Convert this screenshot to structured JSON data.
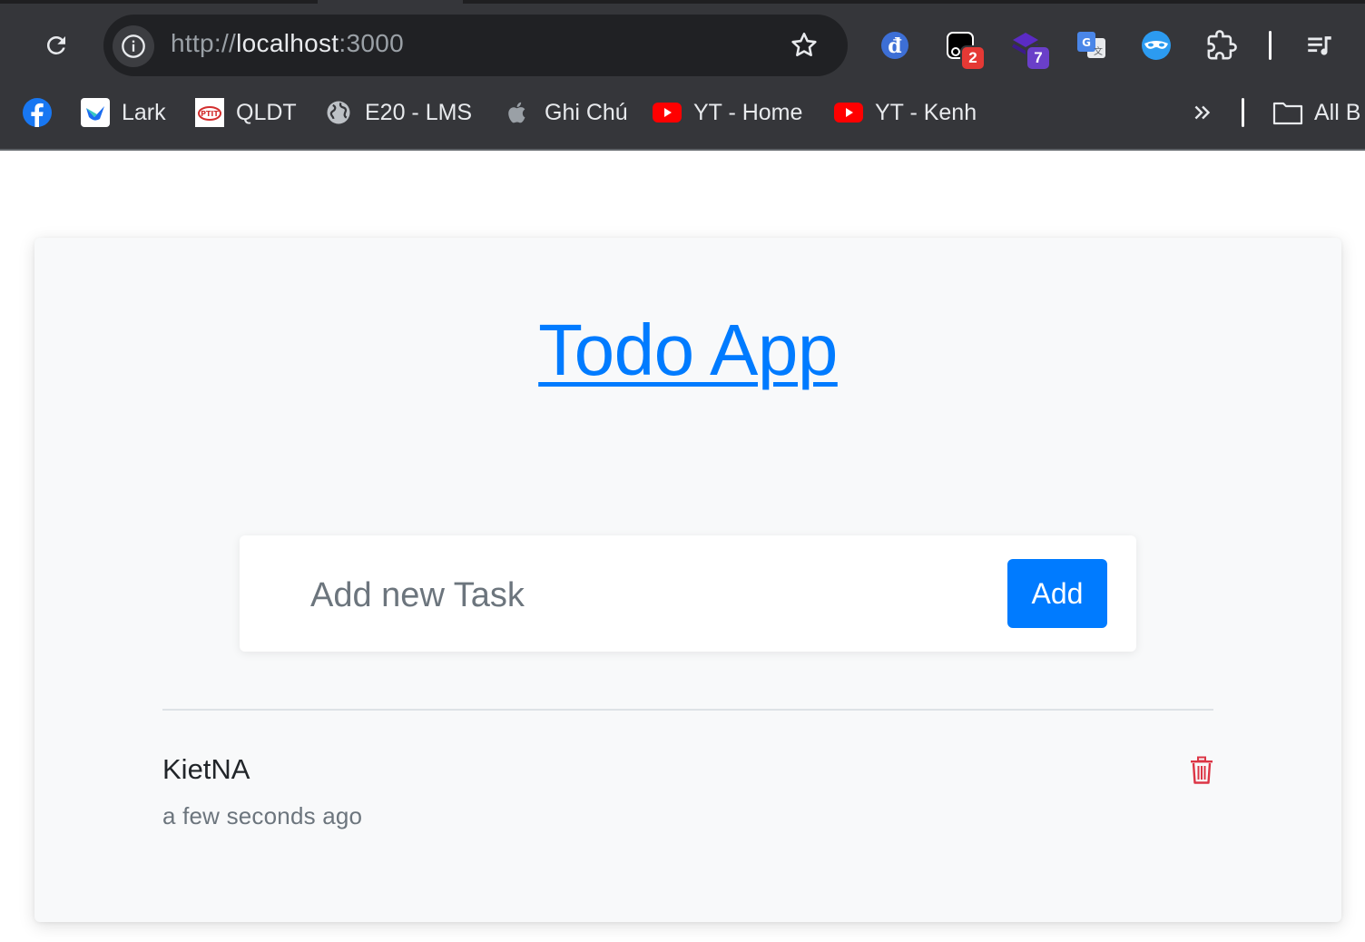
{
  "browser": {
    "url_scheme": "http://",
    "url_host": "localhost",
    "url_port": ":3000",
    "extensions": [
      {
        "icon": "dong-icon"
      },
      {
        "icon": "screenshot-ext-icon",
        "badge": "2",
        "badge_color": "#e53935"
      },
      {
        "icon": "stack-ext-icon",
        "badge": "7",
        "badge_color": "#6a3fc9"
      },
      {
        "icon": "google-translate-icon"
      },
      {
        "icon": "mask-ext-icon"
      },
      {
        "icon": "puzzle-icon"
      },
      {
        "icon": "media-queue-icon"
      }
    ],
    "bookmarks": [
      {
        "icon": "facebook-icon",
        "label": ""
      },
      {
        "icon": "lark-icon",
        "label": "Lark"
      },
      {
        "icon": "ptit-icon",
        "label": "QLDT"
      },
      {
        "icon": "globe-icon",
        "label": "E20 - LMS"
      },
      {
        "icon": "apple-icon",
        "label": "Ghi Chú"
      },
      {
        "icon": "youtube-icon",
        "label": "YT - Home"
      },
      {
        "icon": "youtube-icon",
        "label": "YT - Kenh"
      }
    ],
    "all_bookmarks_label": "All B"
  },
  "app": {
    "title": "Todo App",
    "input_placeholder": "Add new Task",
    "add_label": "Add",
    "tasks": [
      {
        "name": "KietNA",
        "time": "a few seconds ago"
      }
    ]
  },
  "colors": {
    "primary": "#007bff",
    "danger": "#dc3545",
    "chrome": "#35363a",
    "card": "#f8f9fa"
  }
}
